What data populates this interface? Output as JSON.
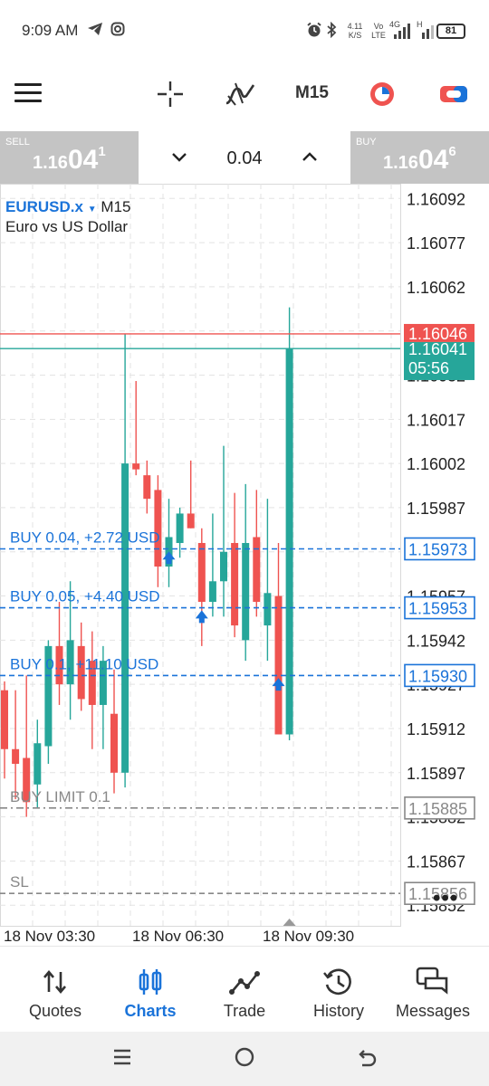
{
  "status_bar": {
    "time": "9:09 AM",
    "net_speed_top": "4.11",
    "net_speed_unit": "K/S",
    "volte_top": "Vo",
    "volte_bottom": "LTE",
    "network": "4G",
    "network2": "H",
    "battery": "81"
  },
  "toolbar": {
    "timeframe": "M15",
    "icons": [
      "menu-icon",
      "crosshair-icon",
      "indicators-icon",
      "timeframe",
      "objects-icon",
      "one-click-trading-icon"
    ]
  },
  "trade_bar": {
    "sell_label": "SELL",
    "sell_price_prefix": "1.16",
    "sell_price_big": "04",
    "sell_price_sup": "1",
    "buy_label": "BUY",
    "buy_price_prefix": "1.16",
    "buy_price_big": "04",
    "buy_price_sup": "6",
    "volume": "0.04"
  },
  "chart_meta": {
    "symbol": "EURUSD.x",
    "timeframe": "M15",
    "description": "Euro vs US Dollar",
    "price_axis": [
      "1.16092",
      "1.16077",
      "1.16062",
      "1.16047",
      "1.16032",
      "1.16017",
      "1.16002",
      "1.15987",
      "1.15972",
      "1.15957",
      "1.15942",
      "1.15927",
      "1.15912",
      "1.15897",
      "1.15882",
      "1.15867",
      "1.15852"
    ],
    "time_axis": [
      "18 Nov 03:30",
      "18 Nov 06:30",
      "18 Nov 09:30"
    ],
    "ask_tag": "1.16046",
    "bid_tag": "1.16041",
    "countdown": "05:56",
    "more": "•••"
  },
  "chart_data": {
    "type": "candlestick",
    "symbol": "EURUSD.x",
    "timeframe": "M15",
    "ylim": [
      1.15845,
      1.16097
    ],
    "grid": true,
    "bid": 1.16041,
    "ask": 1.16046,
    "candles": [
      {
        "o": 1.15925,
        "h": 1.15928,
        "l": 1.15895,
        "c": 1.15905
      },
      {
        "o": 1.15905,
        "h": 1.15925,
        "l": 1.15888,
        "c": 1.159
      },
      {
        "o": 1.15902,
        "h": 1.1593,
        "l": 1.15882,
        "c": 1.15887
      },
      {
        "o": 1.15893,
        "h": 1.15915,
        "l": 1.15885,
        "c": 1.15907
      },
      {
        "o": 1.15906,
        "h": 1.15942,
        "l": 1.159,
        "c": 1.1594
      },
      {
        "o": 1.1594,
        "h": 1.15955,
        "l": 1.1592,
        "c": 1.15927
      },
      {
        "o": 1.15927,
        "h": 1.15962,
        "l": 1.15915,
        "c": 1.15942
      },
      {
        "o": 1.1594,
        "h": 1.15948,
        "l": 1.15918,
        "c": 1.15922
      },
      {
        "o": 1.15935,
        "h": 1.15945,
        "l": 1.15905,
        "c": 1.1592
      },
      {
        "o": 1.1592,
        "h": 1.1594,
        "l": 1.15905,
        "c": 1.15935
      },
      {
        "o": 1.15917,
        "h": 1.15932,
        "l": 1.1589,
        "c": 1.15897
      },
      {
        "o": 1.15897,
        "h": 1.16046,
        "l": 1.15892,
        "c": 1.16002
      },
      {
        "o": 1.16002,
        "h": 1.1603,
        "l": 1.15998,
        "c": 1.16
      },
      {
        "o": 1.15998,
        "h": 1.16003,
        "l": 1.15985,
        "c": 1.1599
      },
      {
        "o": 1.15993,
        "h": 1.15998,
        "l": 1.1596,
        "c": 1.15967
      },
      {
        "o": 1.15967,
        "h": 1.1599,
        "l": 1.1596,
        "c": 1.15977
      },
      {
        "o": 1.15975,
        "h": 1.15987,
        "l": 1.1597,
        "c": 1.15985
      },
      {
        "o": 1.15985,
        "h": 1.16003,
        "l": 1.1598,
        "c": 1.1598
      },
      {
        "o": 1.15975,
        "h": 1.1598,
        "l": 1.1594,
        "c": 1.15955
      },
      {
        "o": 1.15955,
        "h": 1.15985,
        "l": 1.1595,
        "c": 1.15962
      },
      {
        "o": 1.15962,
        "h": 1.16008,
        "l": 1.1595,
        "c": 1.15972
      },
      {
        "o": 1.15975,
        "h": 1.15992,
        "l": 1.15943,
        "c": 1.15947
      },
      {
        "o": 1.15942,
        "h": 1.15995,
        "l": 1.15935,
        "c": 1.15975
      },
      {
        "o": 1.15977,
        "h": 1.15993,
        "l": 1.1595,
        "c": 1.15955
      },
      {
        "o": 1.15947,
        "h": 1.1599,
        "l": 1.15935,
        "c": 1.15958
      },
      {
        "o": 1.15957,
        "h": 1.15975,
        "l": 1.1591,
        "c": 1.1591
      },
      {
        "o": 1.1591,
        "h": 1.16055,
        "l": 1.15908,
        "c": 1.16041
      }
    ],
    "order_lines": [
      {
        "label": "BUY 0.04,   +2.72 USD",
        "price": 1.15973,
        "tag": "1.15973",
        "style": "blue"
      },
      {
        "label": "BUY 0.05,   +4.40 USD",
        "price": 1.15953,
        "tag": "1.15953",
        "style": "blue"
      },
      {
        "label": "BUY 0.1,   +11.10 USD",
        "price": 1.1593,
        "tag": "1.15930",
        "style": "blue"
      },
      {
        "label": "BUY LIMIT 0.1",
        "price": 1.15885,
        "tag": "1.15885",
        "style": "gray-dashdot"
      },
      {
        "label": "SL",
        "price": 1.15856,
        "tag": "1.15856",
        "style": "gray"
      }
    ],
    "trade_markers": [
      {
        "candle": 15,
        "price": 1.1597
      },
      {
        "candle": 18,
        "price": 1.1595
      },
      {
        "candle": 25,
        "price": 1.15927
      }
    ],
    "colors": {
      "bull": "#26a69a",
      "bear": "#ef5350",
      "order": "#1a73d9",
      "ask": "#ef5350",
      "bid": "#26a69a",
      "gray": "#888888"
    }
  },
  "bottom_nav": [
    {
      "label": "Quotes",
      "icon": "quotes-icon"
    },
    {
      "label": "Charts",
      "icon": "charts-icon",
      "active": true
    },
    {
      "label": "Trade",
      "icon": "trade-icon"
    },
    {
      "label": "History",
      "icon": "history-icon"
    },
    {
      "label": "Messages",
      "icon": "messages-icon"
    }
  ]
}
